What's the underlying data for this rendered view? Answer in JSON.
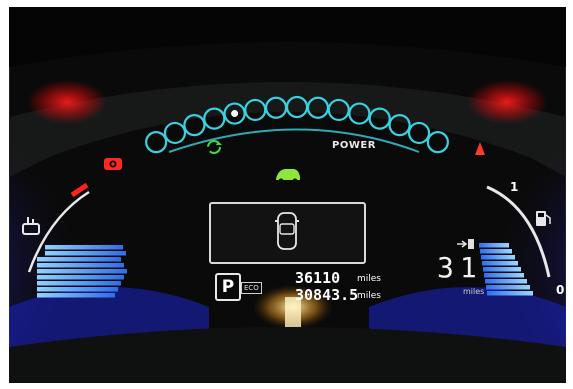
{
  "power_meter": {
    "label": "POWER",
    "total_bubbles": 15,
    "active_bubble": 4
  },
  "odometer": {
    "value": "36110",
    "unit": "miles"
  },
  "trip": {
    "value": "30843.5",
    "unit": "miles"
  },
  "gear": {
    "indicator": "P",
    "eco_badge": "ECO"
  },
  "range": {
    "value": "31",
    "unit": "miles"
  },
  "charge_gauge": {
    "top_mark": "1",
    "bottom_mark": "0"
  },
  "icons": [
    "regen-icon",
    "car-ready-icon",
    "warning-light-icon",
    "parking-brake-icon",
    "battery-temp-icon",
    "fuel-pump-icon",
    "car-top-view-icon"
  ],
  "colors": {
    "power_ring": "#38d2e0",
    "battery_bars": "#3d8cf0",
    "ready_green": "#8fe63a",
    "warning_red": "#ff2a20",
    "side_glow": "#2a3aff"
  }
}
